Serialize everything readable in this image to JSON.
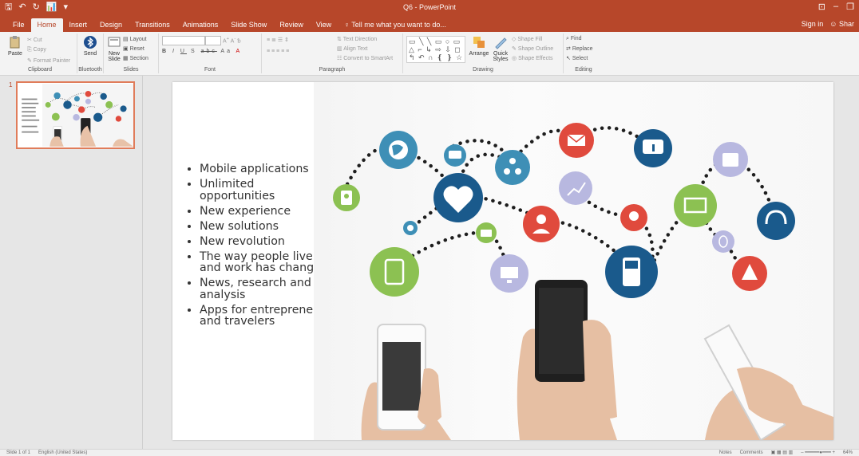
{
  "app": {
    "title": "Q6 - PowerPoint",
    "brand_color": "#b7472a"
  },
  "qat": [
    "save-icon",
    "undo-icon",
    "redo-icon",
    "present-icon",
    "customize-icon"
  ],
  "window_controls": {
    "ribbon_display": "⊡",
    "minimize": "–",
    "restore": "❐"
  },
  "tabs": [
    {
      "label": "File"
    },
    {
      "label": "Home"
    },
    {
      "label": "Insert"
    },
    {
      "label": "Design"
    },
    {
      "label": "Transitions"
    },
    {
      "label": "Animations"
    },
    {
      "label": "Slide Show"
    },
    {
      "label": "Review"
    },
    {
      "label": "View"
    }
  ],
  "tell_me": "Tell me what you want to do...",
  "sign_in": "Sign in",
  "share": "Shar",
  "ribbon": {
    "clipboard": {
      "paste": "Paste",
      "cut": "Cut",
      "copy": "Copy",
      "format_painter": "Format Painter",
      "label": "Clipboard"
    },
    "bluetooth": {
      "send": "Send",
      "label": "Bluetooth"
    },
    "slides": {
      "new_slide": "New Slide",
      "layout": "Layout",
      "reset": "Reset",
      "section": "Section",
      "label": "Slides"
    },
    "font": {
      "bold": "B",
      "italic": "I",
      "underline": "U",
      "strike": "S",
      "abc": "abc",
      "aa": "Aa",
      "label": "Font"
    },
    "paragraph": {
      "text_direction": "Text Direction",
      "align_text": "Align Text",
      "convert_smartart": "Convert to SmartArt",
      "label": "Paragraph"
    },
    "drawing": {
      "arrange": "Arrange",
      "quick_styles": "Quick Styles",
      "shape_fill": "Shape Fill",
      "shape_outline": "Shape Outline",
      "shape_effects": "Shape Effects",
      "label": "Drawing"
    },
    "editing": {
      "find": "Find",
      "replace": "Replace",
      "select": "Select",
      "label": "Editing"
    }
  },
  "thumbnails": [
    {
      "number": "1"
    }
  ],
  "slide": {
    "bullets": [
      "Mobile applications",
      "Unlimited opportunities",
      "New experience",
      "New solutions",
      "New revolution",
      "The way people live and work has changed",
      "News, research and analysis",
      "Apps for entrepreneurs and travelers"
    ]
  },
  "status": {
    "slide_info": "Slide 1 of 1",
    "language": "English (United States)",
    "notes": "Notes",
    "comments": "Comments",
    "zoom": "64%"
  }
}
